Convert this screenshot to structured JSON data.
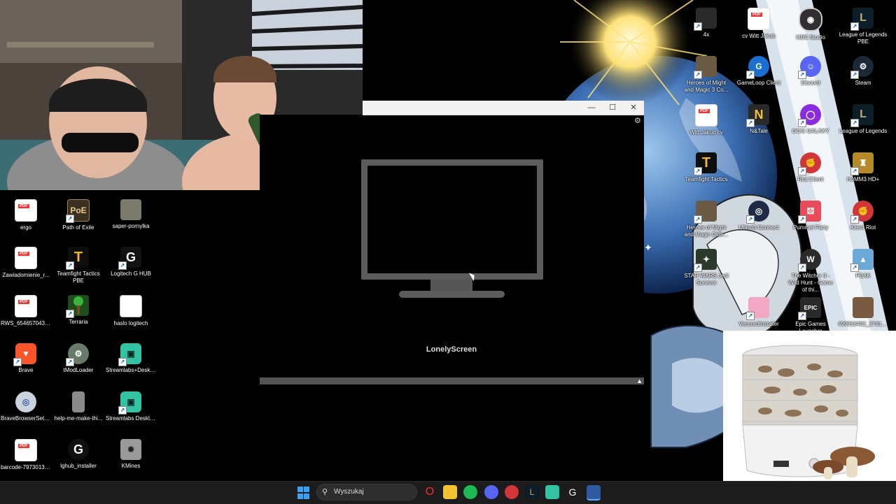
{
  "desktop_icons_left": [
    {
      "label": "ergo",
      "icon": "pdf-icon"
    },
    {
      "label": "Path of Exile",
      "icon": "path-of-exile-icon"
    },
    {
      "label": "saper-pornylka",
      "icon": "image-file-icon"
    },
    {
      "label": "Zawiadomienie_r...",
      "icon": "pdf-icon"
    },
    {
      "label": "Teamfight Tactics PBE",
      "icon": "teamfight-tactics-icon"
    },
    {
      "label": "Logitech G HUB",
      "icon": "logitech-icon"
    },
    {
      "label": "RWS_654657043.PDF",
      "icon": "pdf-icon"
    },
    {
      "label": "Terraria",
      "icon": "terraria-icon"
    },
    {
      "label": "haslo logitech",
      "icon": "text-file-icon"
    },
    {
      "label": "Brave",
      "icon": "brave-icon"
    },
    {
      "label": "tModLoader",
      "icon": "tmodloader-icon"
    },
    {
      "label": "Streamlabs+Deskt...",
      "icon": "streamlabs-icon"
    },
    {
      "label": "BraveBrowserSetu...",
      "icon": "installer-icon"
    },
    {
      "label": "help-me-make-thi...",
      "icon": "image-file-icon"
    },
    {
      "label": "Streamlabs Desktop",
      "icon": "streamlabs-icon"
    },
    {
      "label": "barcode-79730137...",
      "icon": "pdf-icon"
    },
    {
      "label": "lghub_installer",
      "icon": "logitech-icon"
    },
    {
      "label": "KMines",
      "icon": "kmines-icon"
    }
  ],
  "desktop_icons_right": [
    {
      "label": "4x",
      "icon": "shortcut-icon"
    },
    {
      "label": "cv Witt Jakub",
      "icon": "pdf-icon"
    },
    {
      "label": "OBS Studio",
      "icon": "obs-icon"
    },
    {
      "label": "League of Legends PBE",
      "icon": "league-icon"
    },
    {
      "label": "Heroes of Might and Magic 3 Co...",
      "icon": "heroes-icon"
    },
    {
      "label": "GameLoop Client",
      "icon": "gameloop-icon"
    },
    {
      "label": "Discord",
      "icon": "discord-icon"
    },
    {
      "label": "Steam",
      "icon": "steam-icon"
    },
    {
      "label": "Witt Jakub cv",
      "icon": "pdf-icon"
    },
    {
      "label": "N&Tale",
      "icon": "nostale-icon"
    },
    {
      "label": "GOG GALAXY",
      "icon": "gog-icon"
    },
    {
      "label": "League of Legends",
      "icon": "league-icon"
    },
    {
      "label": "Teamfight Tactics",
      "icon": "teamfight-tactics-icon"
    },
    {
      "label": "",
      "icon": "blank"
    },
    {
      "label": "Riot Client",
      "icon": "riot-icon"
    },
    {
      "label": "HoMM3 HD+",
      "icon": "homm3-icon"
    },
    {
      "label": "Heroes of Might and Magic Olde...",
      "icon": "heroes-icon"
    },
    {
      "label": "Ubisoft Connect",
      "icon": "ubisoft-icon"
    },
    {
      "label": "Pummel Party",
      "icon": "pummel-icon"
    },
    {
      "label": "Klient Riot",
      "icon": "riot-icon"
    },
    {
      "label": "STAR WARS Jedi Survivor",
      "icon": "starwars-icon"
    },
    {
      "label": "",
      "icon": "blank"
    },
    {
      "label": "The Witcher 3 - Wild Hunt - Game of thi...",
      "icon": "witcher-icon"
    },
    {
      "label": "PEAK",
      "icon": "peak-icon"
    },
    {
      "label": "",
      "icon": "blank"
    },
    {
      "label": "VencordInstaller",
      "icon": "vencord-icon"
    },
    {
      "label": "Epic Games Launcher",
      "icon": "epic-icon"
    },
    {
      "label": "499918402_279101...",
      "icon": "image-file-icon"
    }
  ],
  "lonelyscreen": {
    "label": "LonelyScreen"
  },
  "taskbar": {
    "search_placeholder": "Wyszukaj"
  }
}
